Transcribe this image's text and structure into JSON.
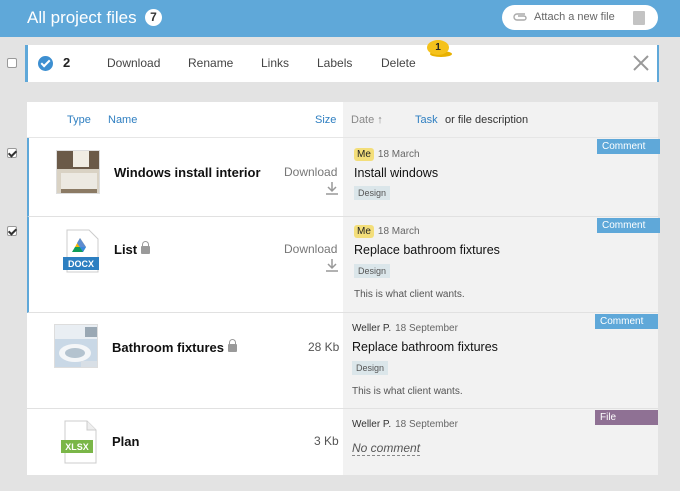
{
  "header": {
    "title": "All project files",
    "count": "7",
    "attach_label": "Attach a new file"
  },
  "actionbar": {
    "selected_count": "2",
    "actions": [
      "Download",
      "Rename",
      "Links",
      "Labels",
      "Delete"
    ],
    "labels_badge": "1"
  },
  "columns": {
    "type": "Type",
    "name": "Name",
    "size": "Size",
    "date": "Date ↑",
    "task": "Task",
    "or_desc": "or file description"
  },
  "rows": [
    {
      "name": "Windows install interior",
      "download": "Download",
      "author": "Me",
      "date": "18 March",
      "task": "Install windows",
      "tag": "Design",
      "kind": "Comment",
      "checked": true
    },
    {
      "name": "List",
      "ext": "DOCX",
      "download": "Download",
      "author": "Me",
      "date": "18 March",
      "task": "Replace bathroom fixtures",
      "tag": "Design",
      "desc": "This is what client wants.",
      "kind": "Comment",
      "checked": true
    },
    {
      "name": "Bathroom fixtures",
      "size": "28 Kb",
      "author": "Weller P.",
      "date": "18 September",
      "task": "Replace bathroom fixtures",
      "tag": "Design",
      "desc": "This is what client wants.",
      "kind": "Comment"
    },
    {
      "name": "Plan",
      "ext": "XLSX",
      "size": "3 Kb",
      "author": "Weller P.",
      "date": "18 September",
      "no_comment": "No comment",
      "kind": "File"
    }
  ],
  "colors": {
    "header": "#5fa8d9",
    "comment": "#5fa8d9",
    "file": "#8f7194",
    "selected_border": "#5fa8d9"
  },
  "icons": [
    "paperclip-icon",
    "file-icon",
    "check-circle-icon",
    "close-icon",
    "download-icon",
    "lock-icon",
    "docx-icon",
    "xlsx-icon"
  ]
}
